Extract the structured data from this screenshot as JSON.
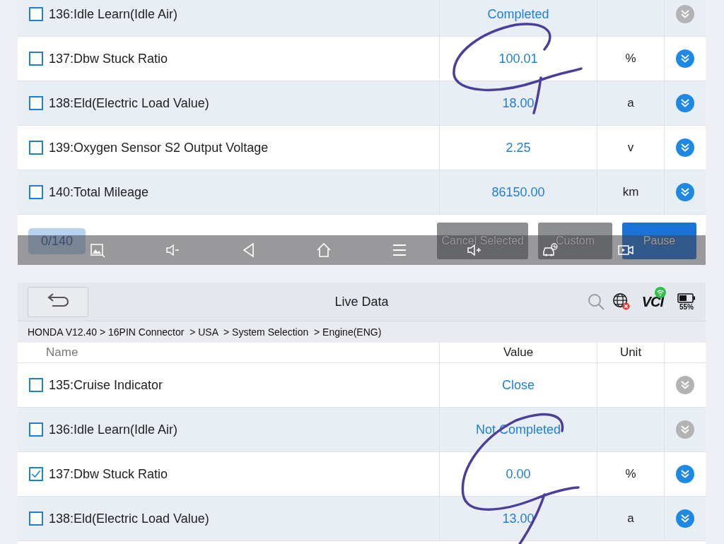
{
  "top_panel": {
    "rows": [
      {
        "name": "136:Idle Learn(Idle Air)",
        "value": "Completed",
        "checked": false,
        "disabled": true
      },
      {
        "name": "137:Dbw Stuck Ratio",
        "value": "100.01",
        "unit": "%",
        "checked": false,
        "disabled": false
      },
      {
        "name": "138:Eld(Electric Load Value)",
        "value": "18.00",
        "unit": "a",
        "checked": false,
        "disabled": false
      },
      {
        "name": "139:Oxygen Sensor S2 Output Voltage",
        "value": "2.25",
        "unit": "v",
        "checked": false,
        "disabled": false
      },
      {
        "name": "140:Total Mileage",
        "value": "86150.00",
        "unit": "km",
        "checked": false,
        "disabled": false
      }
    ],
    "counter": "0/140",
    "buttons": [
      {
        "label": "Cancel Selected",
        "kind": "secondary"
      },
      {
        "label": "Custom",
        "kind": "secondary"
      },
      {
        "label": "Pause",
        "kind": "primary"
      }
    ]
  },
  "bottom_panel": {
    "title": "Live Data",
    "vci_label": "VCI",
    "battery": "55%",
    "breadcrumb": "HONDA V12.40 > 16PIN Connector  > USA  > System Selection  > Engine(ENG)",
    "columns": [
      "Name",
      "Value",
      "Unit"
    ],
    "rows": [
      {
        "name": "135:Cruise Indicator",
        "value": "Close",
        "checked": false,
        "disabled": true
      },
      {
        "name": "136:Idle Learn(Idle Air)",
        "value": "Not Completed",
        "checked": false,
        "disabled": true
      },
      {
        "name": "137:Dbw Stuck Ratio",
        "value": "0.00",
        "unit": "%",
        "checked": true,
        "disabled": false
      },
      {
        "name": "138:Eld(Electric Load Value)",
        "value": "13.00",
        "unit": "a",
        "checked": false,
        "disabled": false
      }
    ]
  }
}
